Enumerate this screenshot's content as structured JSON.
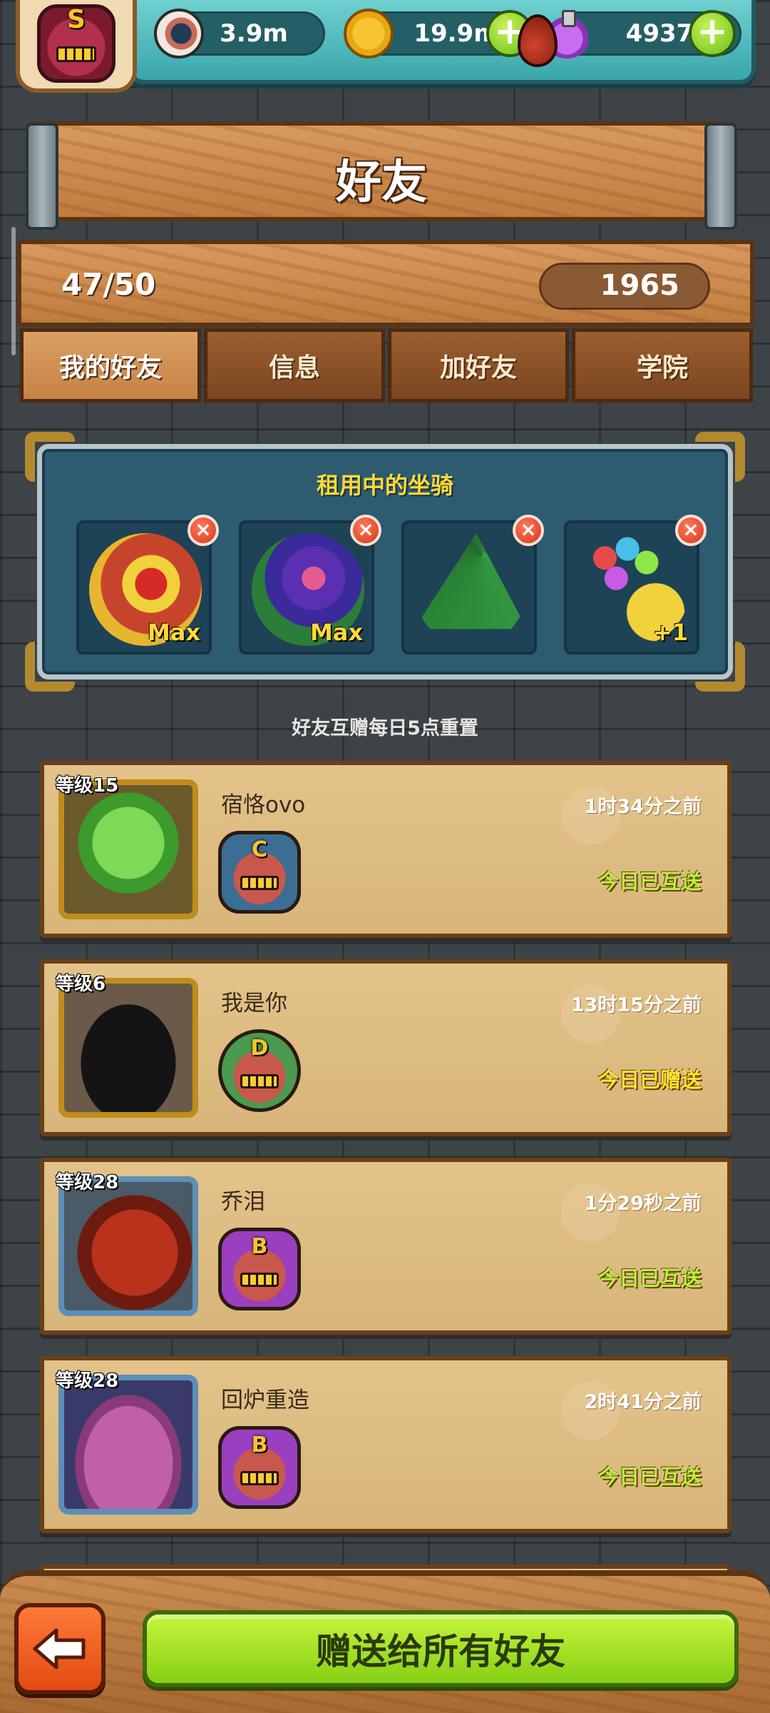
{
  "resources": {
    "eyes": "3.9m",
    "coins": "19.9m",
    "potions": "4937"
  },
  "player": {
    "rank_letter": "S"
  },
  "header": {
    "title": "好友"
  },
  "stats": {
    "friend_count": "47/50",
    "blood": "1965"
  },
  "tabs": [
    {
      "label": "我的好友",
      "active": true
    },
    {
      "label": "信息",
      "active": false
    },
    {
      "label": "加好友",
      "active": false
    },
    {
      "label": "学院",
      "active": false
    }
  ],
  "mounts": {
    "title": "租用中的坐骑",
    "slots": [
      {
        "icon": "lion-dance-mount-icon",
        "badge": "Max"
      },
      {
        "icon": "purple-rose-mount-icon",
        "badge": "Max"
      },
      {
        "icon": "christmas-tree-mount-icon",
        "badge": ""
      },
      {
        "icon": "balloon-duck-mount-icon",
        "badge": "+1"
      }
    ]
  },
  "reset_note": "好友互赠每日5点重置",
  "friends": [
    {
      "level": "等级15",
      "name": "宿恪ovo",
      "time": "1时34分之前",
      "status": "今日已互送",
      "rank": "C",
      "avatar": "lettuce-monster-icon"
    },
    {
      "level": "等级6",
      "name": "我是你",
      "time": "13时15分之前",
      "status": "今日已赠送",
      "rank": "D",
      "avatar": "black-blob-monster-icon"
    },
    {
      "level": "等级28",
      "name": "乔泪",
      "time": "1分29秒之前",
      "status": "今日已互送",
      "rank": "B",
      "avatar": "red-dragon-monster-icon"
    },
    {
      "level": "等级28",
      "name": "回炉重造",
      "time": "2时41分之前",
      "status": "今日已互送",
      "rank": "B",
      "avatar": "pink-fuzzy-monster-icon"
    }
  ],
  "actions": {
    "send_all": "赠送给所有好友"
  },
  "colors": {
    "status_mutual": "#b6f23a",
    "status_sent": "#ffe52c",
    "accent_green": "#86cf14"
  }
}
